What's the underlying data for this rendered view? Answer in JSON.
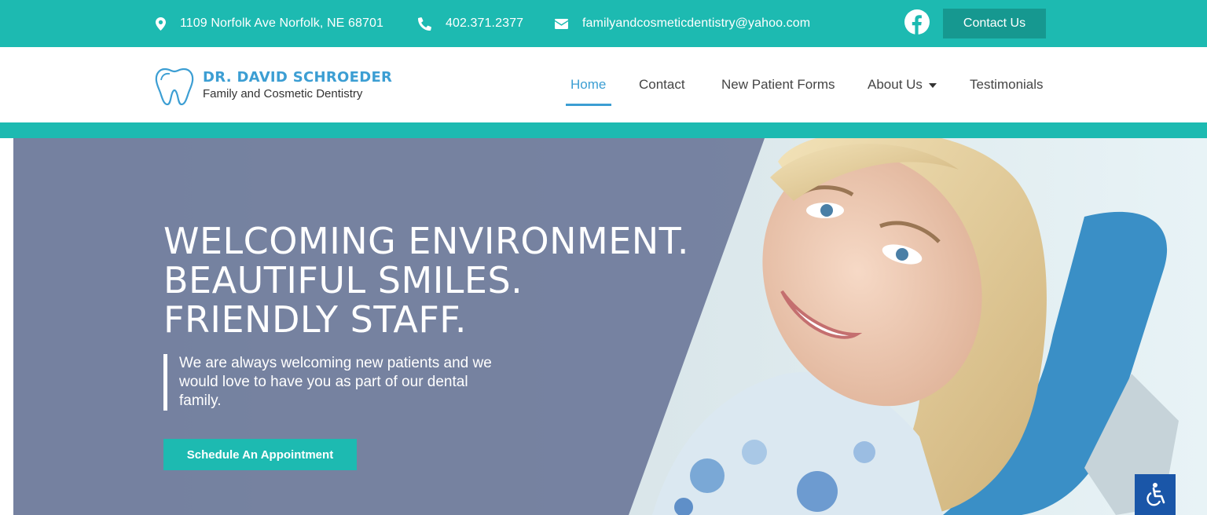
{
  "topbar": {
    "address": "1109 Norfolk Ave Norfolk, NE 68701",
    "phone": "402.371.2377",
    "email": "familyandcosmeticdentistry@yahoo.com",
    "contact_label": "Contact Us",
    "icons": [
      "map-pin-icon",
      "phone-icon",
      "envelope-icon",
      "facebook-icon"
    ]
  },
  "logo": {
    "name": "DR. DAVID SCHROEDER",
    "subtitle": "Family and Cosmetic Dentistry"
  },
  "nav": {
    "items": [
      "Home",
      "Contact",
      "New Patient Forms",
      "About Us",
      "Testimonials"
    ],
    "active": "Home"
  },
  "hero": {
    "headline": [
      "WELCOMING ENVIRONMENT.",
      "BEAUTIFUL SMILES.",
      "FRIENDLY STAFF."
    ],
    "subtext": "We are always welcoming new patients and we would love to have you as part of our dental family.",
    "cta_label": "Schedule An Appointment"
  },
  "colors": {
    "teal": "#1dbab1",
    "teal_dark": "#169890",
    "blue": "#3c9ed3",
    "overlay": "#6e7a9a",
    "accessibility_blue": "#1a56a8"
  }
}
